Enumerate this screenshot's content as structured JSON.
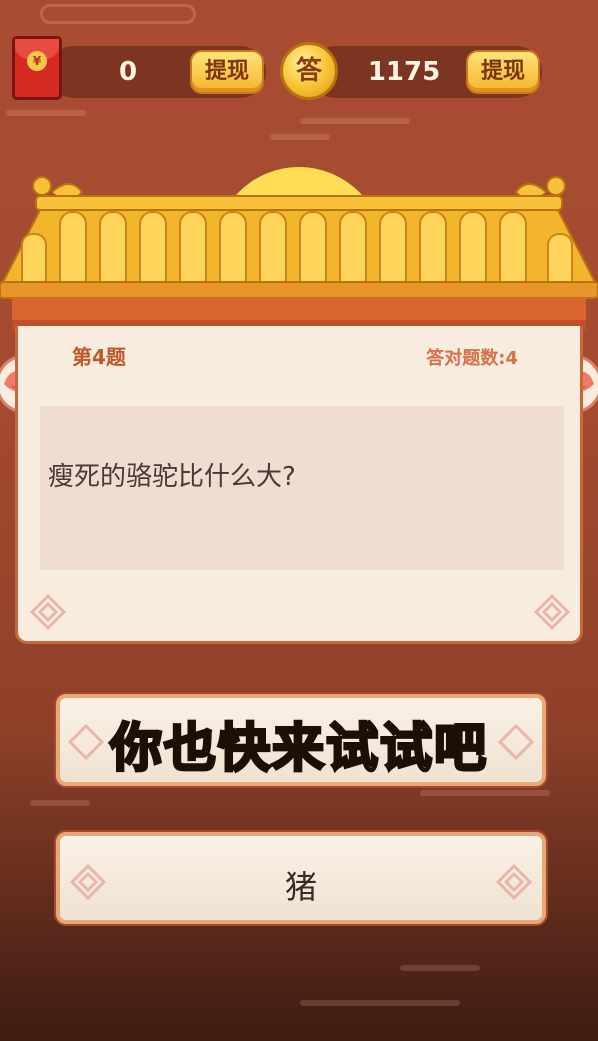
{
  "header": {
    "red_packet_amount": "0",
    "withdraw_label_1": "提现",
    "coin_glyph": "答",
    "coin_amount": "1175",
    "withdraw_label_2": "提现",
    "red_packet_glyph": "¥"
  },
  "question": {
    "number_label": "第4题",
    "answered_count_label": "答对题数:4",
    "text": "瘦死的骆驼比什么大?"
  },
  "answers": [
    {
      "label": "你也快来试试吧"
    },
    {
      "label": "猪"
    }
  ],
  "overlay_caption": "你也快来试试吧",
  "colors": {
    "background": "#a84d32",
    "accent_gold": "#f5c230",
    "panel": "#f7ecdd",
    "overlay_text": "#ffdf2e"
  }
}
